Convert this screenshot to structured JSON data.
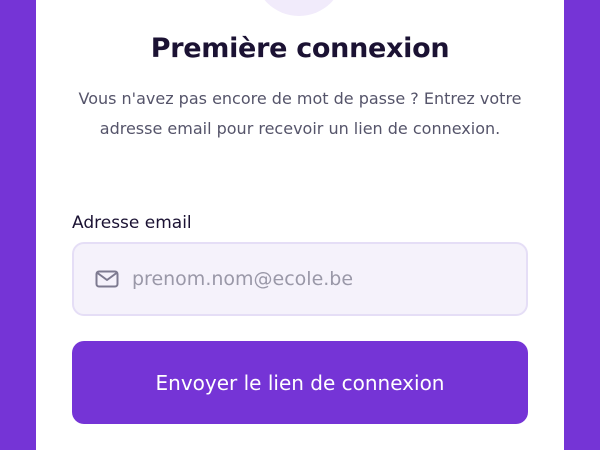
{
  "page": {
    "title": "Première connexion",
    "subtitle": "Vous n'avez pas encore de mot de passe ? Entrez votre adresse email pour recevoir un lien de connexion."
  },
  "form": {
    "email_label": "Adresse email",
    "email_placeholder": "prenom.nom@ecole.be",
    "email_value": "",
    "email_icon": "mail-icon",
    "submit_label": "Envoyer le lien de connexion"
  },
  "colors": {
    "brand": "#7534d6",
    "card_background": "#ffffff",
    "input_background": "#f5f2fb",
    "input_border": "#e5def6",
    "title_text": "#1b1233",
    "body_text": "#55546a",
    "placeholder_text": "#9a98a8",
    "badge_background": "#f1ebfb"
  }
}
